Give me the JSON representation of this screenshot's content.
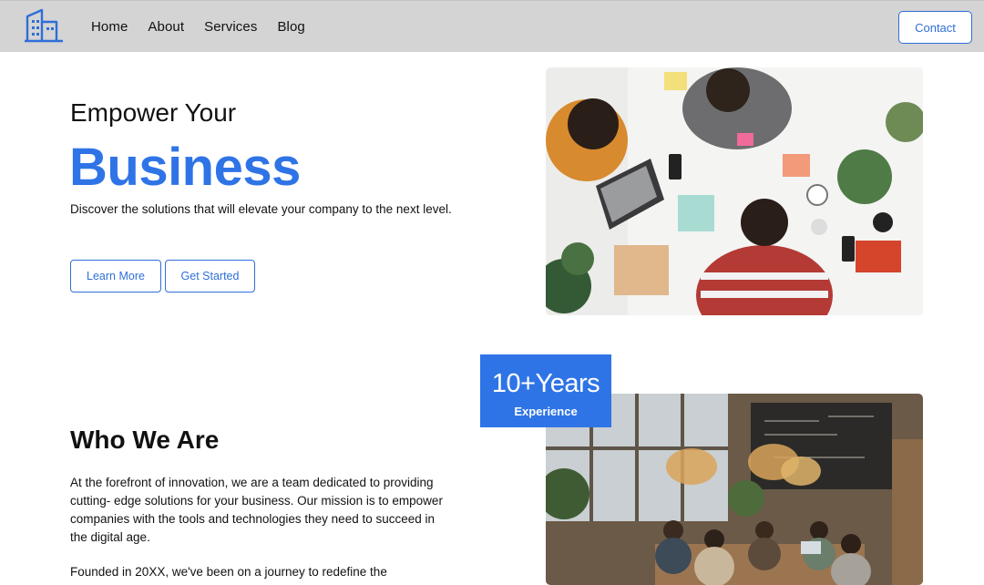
{
  "nav": {
    "links": [
      "Home",
      "About",
      "Services",
      "Blog"
    ],
    "contact_label": "Contact",
    "logo_icon": "building-icon"
  },
  "hero": {
    "kicker": "Empower Your",
    "title": "Business",
    "description": "Discover the solutions that will elevate your company to the next level.",
    "learn_more_label": "Learn More",
    "get_started_label": "Get Started",
    "image_icon": "team-meeting-photo"
  },
  "about": {
    "badge_number": "10+Years",
    "badge_label": "Experience",
    "title": "Who We Are",
    "paragraph1": "At the forefront of innovation, we are a team dedicated to providing cutting- edge solutions for your business. Our mission is to empower companies with the tools and technologies they need to succeed in the digital age.",
    "paragraph2": "Founded in 20XX, we've been on a journey to redefine the",
    "image_icon": "cafe-workspace-photo"
  },
  "colors": {
    "accent": "#2f74e6",
    "navbar_bg": "#d4d4d4"
  }
}
